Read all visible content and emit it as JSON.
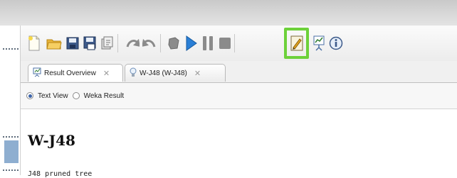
{
  "toolbar": {
    "icons": [
      "new-file-icon",
      "open-folder-icon",
      "save-icon",
      "save-as-icon",
      "export-icon",
      "undo-icon",
      "redo-icon",
      "stop-all-icon",
      "run-icon",
      "pause-icon",
      "stop-icon",
      "build-icon",
      "result-viewer-icon",
      "info-icon"
    ],
    "highlight_color": "#6dd13a"
  },
  "tabs": [
    {
      "label": "Result Overview",
      "close": "✕"
    },
    {
      "label": "W-J48 (W-J48)",
      "close": "✕"
    }
  ],
  "view_options": [
    {
      "label": "Text View",
      "selected": true
    },
    {
      "label": "Weka Result",
      "selected": false
    }
  ],
  "content": {
    "heading": "W-J48",
    "subtext": "J48 pruned tree"
  },
  "colors": {
    "run": "#2a7fd6",
    "folder": "#e9b53b",
    "disk": "#3d5a8a",
    "gray_icon": "#8b8b8b"
  }
}
